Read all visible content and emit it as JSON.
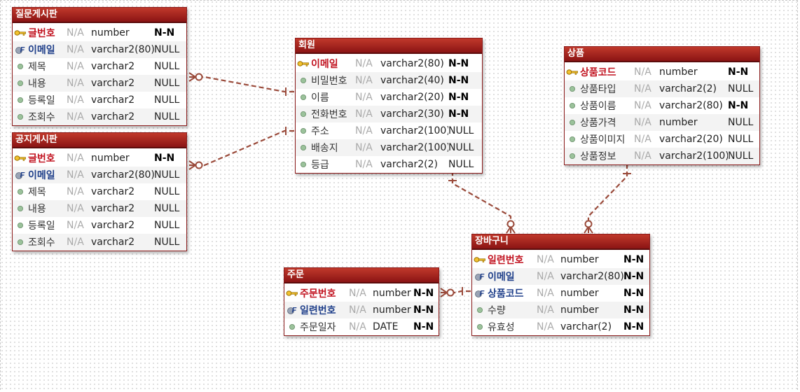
{
  "entities": [
    {
      "id": "qna",
      "title": "질문게시판",
      "columns": [
        {
          "key": "pk",
          "name": "글번호",
          "na": "N/A",
          "type": "number",
          "null": "N-N"
        },
        {
          "key": "fk",
          "name": "이메일",
          "na": "N/A",
          "type": "varchar2(80)",
          "null": "NULL"
        },
        {
          "key": "col",
          "name": "제목",
          "na": "N/A",
          "type": "varchar2",
          "null": "NULL"
        },
        {
          "key": "col",
          "name": "내용",
          "na": "N/A",
          "type": "varchar2",
          "null": "NULL"
        },
        {
          "key": "col",
          "name": "등록일",
          "na": "N/A",
          "type": "varchar2",
          "null": "NULL"
        },
        {
          "key": "col",
          "name": "조회수",
          "na": "N/A",
          "type": "varchar2",
          "null": "NULL"
        }
      ]
    },
    {
      "id": "notice",
      "title": "공지게시판",
      "columns": [
        {
          "key": "pk",
          "name": "글번호",
          "na": "N/A",
          "type": "number",
          "null": "N-N"
        },
        {
          "key": "fk",
          "name": "이메일",
          "na": "N/A",
          "type": "varchar2(80)",
          "null": "NULL"
        },
        {
          "key": "col",
          "name": "제목",
          "na": "N/A",
          "type": "varchar2",
          "null": "NULL"
        },
        {
          "key": "col",
          "name": "내용",
          "na": "N/A",
          "type": "varchar2",
          "null": "NULL"
        },
        {
          "key": "col",
          "name": "등록일",
          "na": "N/A",
          "type": "varchar2",
          "null": "NULL"
        },
        {
          "key": "col",
          "name": "조회수",
          "na": "N/A",
          "type": "varchar2",
          "null": "NULL"
        }
      ]
    },
    {
      "id": "member",
      "title": "회원",
      "columns": [
        {
          "key": "pk",
          "name": "이메일",
          "na": "N/A",
          "type": "varchar2(80)",
          "null": "N-N"
        },
        {
          "key": "col",
          "name": "비밀번호",
          "na": "N/A",
          "type": "varchar2(40)",
          "null": "N-N"
        },
        {
          "key": "col",
          "name": "이름",
          "na": "N/A",
          "type": "varchar2(20)",
          "null": "N-N"
        },
        {
          "key": "col",
          "name": "전화번호",
          "na": "N/A",
          "type": "varchar2(30)",
          "null": "N-N"
        },
        {
          "key": "col",
          "name": "주소",
          "na": "N/A",
          "type": "varchar2(100)",
          "null": "NULL"
        },
        {
          "key": "col",
          "name": "배송지",
          "na": "N/A",
          "type": "varchar2(100)",
          "null": "NULL"
        },
        {
          "key": "col",
          "name": "등급",
          "na": "N/A",
          "type": "varchar2(2)",
          "null": "NULL"
        }
      ]
    },
    {
      "id": "product",
      "title": "상품",
      "columns": [
        {
          "key": "pk",
          "name": "상품코드",
          "na": "N/A",
          "type": "number",
          "null": "N-N"
        },
        {
          "key": "col",
          "name": "상품타입",
          "na": "N/A",
          "type": "varchar2(2)",
          "null": "NULL"
        },
        {
          "key": "col",
          "name": "상품이름",
          "na": "N/A",
          "type": "varchar2(80)",
          "null": "N-N"
        },
        {
          "key": "col",
          "name": "상품가격",
          "na": "N/A",
          "type": "number",
          "null": "NULL"
        },
        {
          "key": "col",
          "name": "상품이미지",
          "na": "N/A",
          "type": "varchar2(20)",
          "null": "NULL"
        },
        {
          "key": "col",
          "name": "상품정보",
          "na": "N/A",
          "type": "varchar2(100)",
          "null": "NULL"
        }
      ]
    },
    {
      "id": "cart",
      "title": "장바구니",
      "columns": [
        {
          "key": "pk",
          "name": "일련번호",
          "na": "N/A",
          "type": "number",
          "null": "N-N"
        },
        {
          "key": "fk",
          "name": "이메일",
          "na": "N/A",
          "type": "varchar2(80)",
          "null": "N-N"
        },
        {
          "key": "fk",
          "name": "상품코드",
          "na": "N/A",
          "type": "number",
          "null": "N-N"
        },
        {
          "key": "col",
          "name": "수량",
          "na": "N/A",
          "type": "number",
          "null": "N-N"
        },
        {
          "key": "col",
          "name": "유효성",
          "na": "N/A",
          "type": "varchar(2)",
          "null": "N-N"
        }
      ]
    },
    {
      "id": "order",
      "title": "주문",
      "columns": [
        {
          "key": "pk",
          "name": "주문번호",
          "na": "N/A",
          "type": "number",
          "null": "N-N"
        },
        {
          "key": "fk",
          "name": "일련번호",
          "na": "N/A",
          "type": "number",
          "null": "N-N"
        },
        {
          "key": "col",
          "name": "주문일자",
          "na": "N/A",
          "type": "DATE",
          "null": "N-N"
        }
      ]
    }
  ],
  "relationships": [
    {
      "parent": "member",
      "child": "qna"
    },
    {
      "parent": "member",
      "child": "notice"
    },
    {
      "parent": "member",
      "child": "cart"
    },
    {
      "parent": "product",
      "child": "cart"
    },
    {
      "parent": "cart",
      "child": "order"
    }
  ],
  "colors": {
    "header": "#a01c1c",
    "relationship_line": "#9a4a3a",
    "pk_text": "#c1121f",
    "fk_text": "#1f3f8a"
  }
}
